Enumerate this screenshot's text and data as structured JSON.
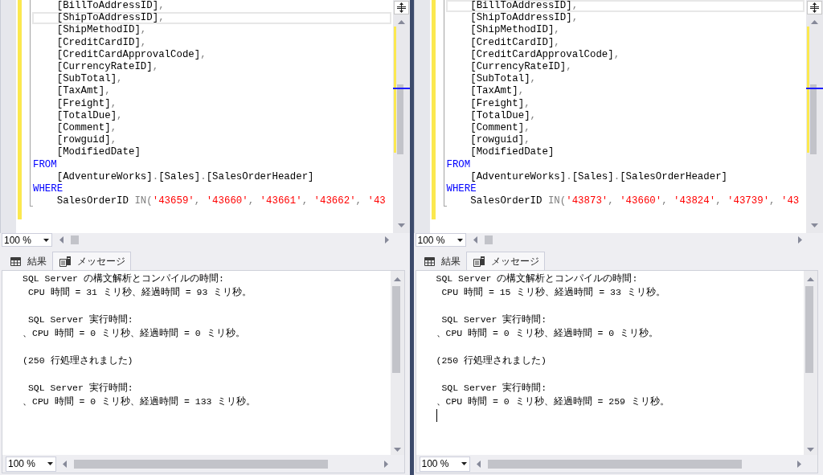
{
  "panes": [
    {
      "editor": {
        "lines": [
          {
            "current": false,
            "tokens": [
              {
                "text": "    [BillToAddressID]",
                "kind": "name"
              },
              {
                "text": ",",
                "kind": "punct"
              }
            ]
          },
          {
            "current": true,
            "tokens": [
              {
                "text": "    [ShipToAddressID]",
                "kind": "name"
              },
              {
                "text": ",",
                "kind": "punct"
              }
            ]
          },
          {
            "current": false,
            "tokens": [
              {
                "text": "    [ShipMethodID]",
                "kind": "name"
              },
              {
                "text": ",",
                "kind": "punct"
              }
            ]
          },
          {
            "current": false,
            "tokens": [
              {
                "text": "    [CreditCardID]",
                "kind": "name"
              },
              {
                "text": ",",
                "kind": "punct"
              }
            ]
          },
          {
            "current": false,
            "tokens": [
              {
                "text": "    [CreditCardApprovalCode]",
                "kind": "name"
              },
              {
                "text": ",",
                "kind": "punct"
              }
            ]
          },
          {
            "current": false,
            "tokens": [
              {
                "text": "    [CurrencyRateID]",
                "kind": "name"
              },
              {
                "text": ",",
                "kind": "punct"
              }
            ]
          },
          {
            "current": false,
            "tokens": [
              {
                "text": "    [SubTotal]",
                "kind": "name"
              },
              {
                "text": ",",
                "kind": "punct"
              }
            ]
          },
          {
            "current": false,
            "tokens": [
              {
                "text": "    [TaxAmt]",
                "kind": "name"
              },
              {
                "text": ",",
                "kind": "punct"
              }
            ]
          },
          {
            "current": false,
            "tokens": [
              {
                "text": "    [Freight]",
                "kind": "name"
              },
              {
                "text": ",",
                "kind": "punct"
              }
            ]
          },
          {
            "current": false,
            "tokens": [
              {
                "text": "    [TotalDue]",
                "kind": "name"
              },
              {
                "text": ",",
                "kind": "punct"
              }
            ]
          },
          {
            "current": false,
            "tokens": [
              {
                "text": "    [Comment]",
                "kind": "name"
              },
              {
                "text": ",",
                "kind": "punct"
              }
            ]
          },
          {
            "current": false,
            "tokens": [
              {
                "text": "    [rowguid]",
                "kind": "name"
              },
              {
                "text": ",",
                "kind": "punct"
              }
            ]
          },
          {
            "current": false,
            "tokens": [
              {
                "text": "    [ModifiedDate]",
                "kind": "name"
              }
            ]
          },
          {
            "current": false,
            "tokens": [
              {
                "text": "FROM",
                "kind": "keyword"
              }
            ]
          },
          {
            "current": false,
            "tokens": [
              {
                "text": "    [AdventureWorks]",
                "kind": "name"
              },
              {
                "text": ".",
                "kind": "punct"
              },
              {
                "text": "[Sales]",
                "kind": "name"
              },
              {
                "text": ".",
                "kind": "punct"
              },
              {
                "text": "[SalesOrderHeader]",
                "kind": "name"
              }
            ]
          },
          {
            "current": false,
            "tokens": [
              {
                "text": "WHERE",
                "kind": "keyword"
              }
            ]
          },
          {
            "current": false,
            "tokens": [
              {
                "text": "    SalesOrderID ",
                "kind": "name"
              },
              {
                "text": "IN(",
                "kind": "operator"
              },
              {
                "text": "'43659'",
                "kind": "string"
              },
              {
                "text": ", ",
                "kind": "punct"
              },
              {
                "text": "'43660'",
                "kind": "string"
              },
              {
                "text": ", ",
                "kind": "punct"
              },
              {
                "text": "'43661'",
                "kind": "string"
              },
              {
                "text": ", ",
                "kind": "punct"
              },
              {
                "text": "'43662'",
                "kind": "string"
              },
              {
                "text": ", ",
                "kind": "punct"
              },
              {
                "text": "'43",
                "kind": "string"
              }
            ]
          }
        ]
      },
      "editor_zoom": "100 %",
      "tabs": [
        {
          "label": "結果",
          "selected": false
        },
        {
          "label": "メッセージ",
          "selected": true
        }
      ],
      "messages": {
        "blocks": [
          [
            "SQL Server の構文解析とコンパイルの時間:",
            " CPU 時間 = 31 ミリ秒、経過時間 = 93 ミリ秒。"
          ],
          [
            " SQL Server 実行時間:",
            "、CPU 時間 = 0 ミリ秒、経過時間 = 0 ミリ秒。"
          ],
          [
            "(250 行処理されました)"
          ],
          [
            " SQL Server 実行時間:",
            "、CPU 時間 = 0 ミリ秒、経過時間 = 133 ミリ秒。"
          ]
        ],
        "cursor": false
      },
      "messages_zoom": "100 %"
    },
    {
      "editor": {
        "lines": [
          {
            "current": true,
            "tokens": [
              {
                "text": "    [BillToAddressID]",
                "kind": "name"
              },
              {
                "text": ",",
                "kind": "punct"
              }
            ]
          },
          {
            "current": false,
            "tokens": [
              {
                "text": "    [ShipToAddressID]",
                "kind": "name"
              },
              {
                "text": ",",
                "kind": "punct"
              }
            ]
          },
          {
            "current": false,
            "tokens": [
              {
                "text": "    [ShipMethodID]",
                "kind": "name"
              },
              {
                "text": ",",
                "kind": "punct"
              }
            ]
          },
          {
            "current": false,
            "tokens": [
              {
                "text": "    [CreditCardID]",
                "kind": "name"
              },
              {
                "text": ",",
                "kind": "punct"
              }
            ]
          },
          {
            "current": false,
            "tokens": [
              {
                "text": "    [CreditCardApprovalCode]",
                "kind": "name"
              },
              {
                "text": ",",
                "kind": "punct"
              }
            ]
          },
          {
            "current": false,
            "tokens": [
              {
                "text": "    [CurrencyRateID]",
                "kind": "name"
              },
              {
                "text": ",",
                "kind": "punct"
              }
            ]
          },
          {
            "current": false,
            "tokens": [
              {
                "text": "    [SubTotal]",
                "kind": "name"
              },
              {
                "text": ",",
                "kind": "punct"
              }
            ]
          },
          {
            "current": false,
            "tokens": [
              {
                "text": "    [TaxAmt]",
                "kind": "name"
              },
              {
                "text": ",",
                "kind": "punct"
              }
            ]
          },
          {
            "current": false,
            "tokens": [
              {
                "text": "    [Freight]",
                "kind": "name"
              },
              {
                "text": ",",
                "kind": "punct"
              }
            ]
          },
          {
            "current": false,
            "tokens": [
              {
                "text": "    [TotalDue]",
                "kind": "name"
              },
              {
                "text": ",",
                "kind": "punct"
              }
            ]
          },
          {
            "current": false,
            "tokens": [
              {
                "text": "    [Comment]",
                "kind": "name"
              },
              {
                "text": ",",
                "kind": "punct"
              }
            ]
          },
          {
            "current": false,
            "tokens": [
              {
                "text": "    [rowguid]",
                "kind": "name"
              },
              {
                "text": ",",
                "kind": "punct"
              }
            ]
          },
          {
            "current": false,
            "tokens": [
              {
                "text": "    [ModifiedDate]",
                "kind": "name"
              }
            ]
          },
          {
            "current": false,
            "tokens": [
              {
                "text": "FROM",
                "kind": "keyword"
              }
            ]
          },
          {
            "current": false,
            "tokens": [
              {
                "text": "    [AdventureWorks]",
                "kind": "name"
              },
              {
                "text": ".",
                "kind": "punct"
              },
              {
                "text": "[Sales]",
                "kind": "name"
              },
              {
                "text": ".",
                "kind": "punct"
              },
              {
                "text": "[SalesOrderHeader]",
                "kind": "name"
              }
            ]
          },
          {
            "current": false,
            "tokens": [
              {
                "text": "WHERE",
                "kind": "keyword"
              }
            ]
          },
          {
            "current": false,
            "tokens": [
              {
                "text": "    SalesOrderID ",
                "kind": "name"
              },
              {
                "text": "IN(",
                "kind": "operator"
              },
              {
                "text": "'43873'",
                "kind": "string"
              },
              {
                "text": ", ",
                "kind": "punct"
              },
              {
                "text": "'43660'",
                "kind": "string"
              },
              {
                "text": ", ",
                "kind": "punct"
              },
              {
                "text": "'43824'",
                "kind": "string"
              },
              {
                "text": ", ",
                "kind": "punct"
              },
              {
                "text": "'43739'",
                "kind": "string"
              },
              {
                "text": ", ",
                "kind": "punct"
              },
              {
                "text": "'43",
                "kind": "string"
              }
            ]
          }
        ]
      },
      "editor_zoom": "100 %",
      "tabs": [
        {
          "label": "結果",
          "selected": false
        },
        {
          "label": "メッセージ",
          "selected": true
        }
      ],
      "messages": {
        "blocks": [
          [
            "SQL Server の構文解析とコンパイルの時間:",
            " CPU 時間 = 15 ミリ秒、経過時間 = 33 ミリ秒。"
          ],
          [
            " SQL Server 実行時間:",
            "、CPU 時間 = 0 ミリ秒、経過時間 = 0 ミリ秒。"
          ],
          [
            "(250 行処理されました)"
          ],
          [
            " SQL Server 実行時間:",
            "、CPU 時間 = 0 ミリ秒、経過時間 = 259 ミリ秒。"
          ]
        ],
        "cursor": true
      },
      "messages_zoom": "100 %"
    }
  ]
}
